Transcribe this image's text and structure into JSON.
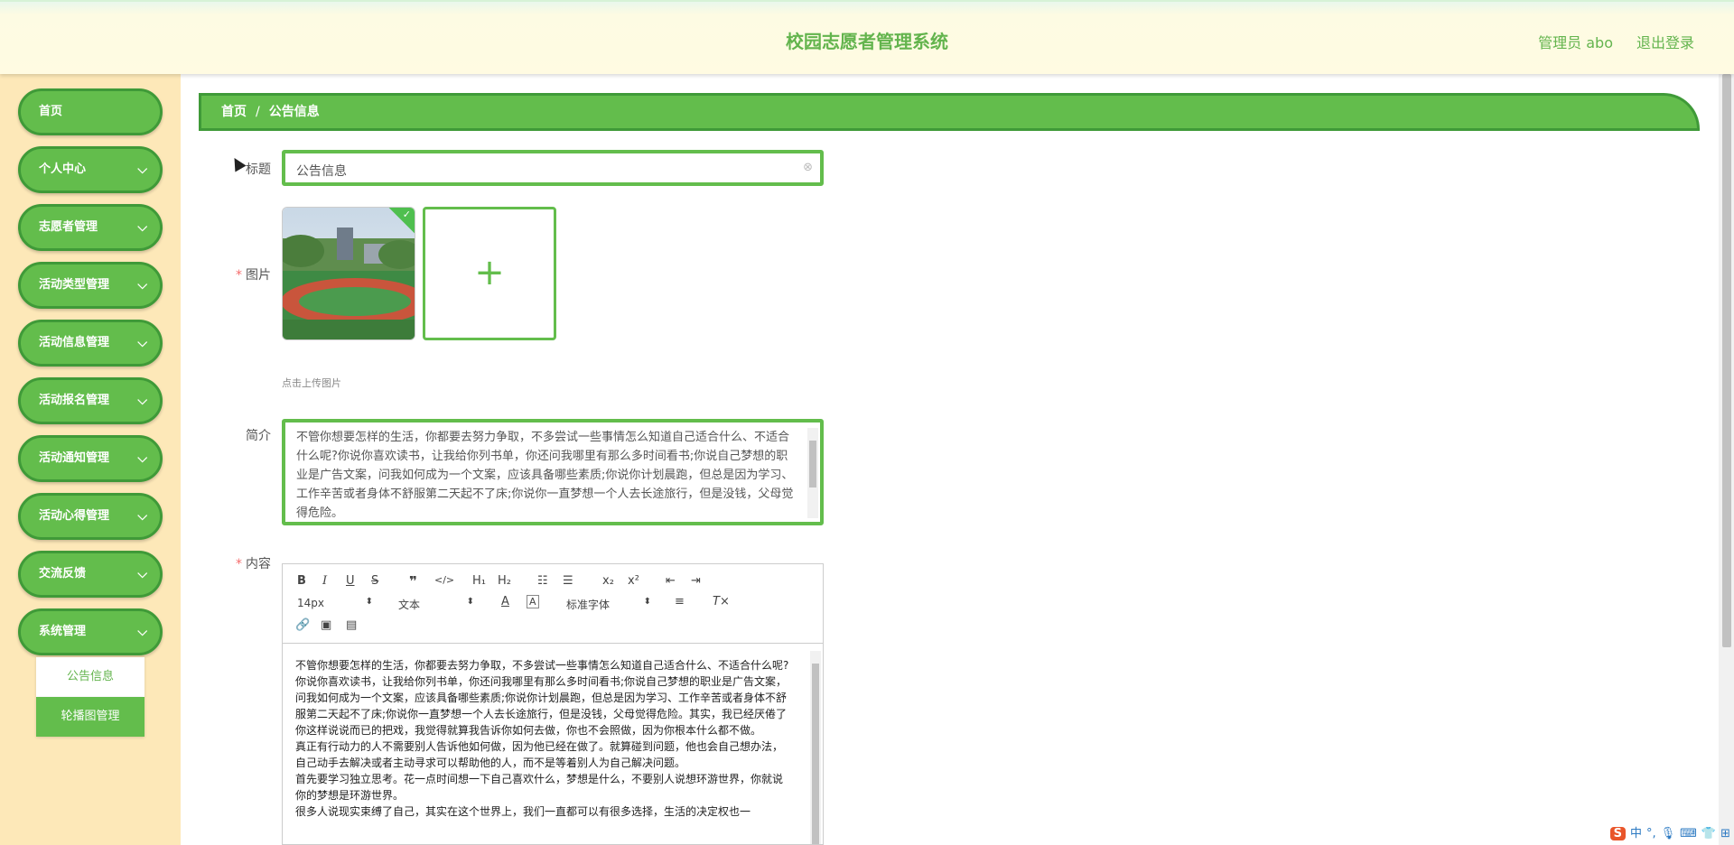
{
  "header": {
    "title": "校园志愿者管理系统",
    "admin": "管理员 abo",
    "logout": "退出登录"
  },
  "sidebar": {
    "items": [
      {
        "label": "首页",
        "has_children": false
      },
      {
        "label": "个人中心",
        "has_children": true
      },
      {
        "label": "志愿者管理",
        "has_children": true
      },
      {
        "label": "活动类型管理",
        "has_children": true
      },
      {
        "label": "活动信息管理",
        "has_children": true
      },
      {
        "label": "活动报名管理",
        "has_children": true
      },
      {
        "label": "活动通知管理",
        "has_children": true
      },
      {
        "label": "活动心得管理",
        "has_children": true
      },
      {
        "label": "交流反馈",
        "has_children": true
      },
      {
        "label": "系统管理",
        "has_children": true
      }
    ],
    "submenu": [
      {
        "label": "公告信息",
        "active": true
      },
      {
        "label": "轮播图管理",
        "active": false
      }
    ],
    "chevron_icon": "chevron-down-icon"
  },
  "breadcrumb": {
    "home": "首页",
    "separator": "/",
    "current": "公告信息"
  },
  "form": {
    "title_label": "标题",
    "title_value": "公告信息",
    "image_label": "图片",
    "upload_plus": "+",
    "upload_tip": "点击上传图片",
    "intro_label": "简介",
    "intro_value": "不管你想要怎样的生活，你都要去努力争取，不多尝试一些事情怎么知道自己适合什么、不适合什么呢?你说你喜欢读书，让我给你列书单，你还问我哪里有那么多时间看书;你说自己梦想的职业是广告文案，问我如何成为一个文案，应该具备哪些素质;你说你计划晨跑，但总是因为学习、工作辛苦或者身体不舒服第二天起不了床;你说你一直梦想一个人去长途旅行，但是没钱，父母觉得危险。",
    "content_label": "内容",
    "required_mark": "*"
  },
  "editor": {
    "font_size": "14px",
    "block_type": "文本",
    "font_family": "标准字体",
    "paragraphs": [
      "不管你想要怎样的生活，你都要去努力争取，不多尝试一些事情怎么知道自己适合什么、不适合什么呢?",
      "你说你喜欢读书，让我给你列书单，你还问我哪里有那么多时间看书;你说自己梦想的职业是广告文案，问我如何成为一个文案，应该具备哪些素质;你说你计划晨跑，但总是因为学习、工作辛苦或者身体不舒服第二天起不了床;你说你一直梦想一个人去长途旅行，但是没钱，父母觉得危险。其实，我已经厌倦了你这样说说而已的把戏，我觉得就算我告诉你如何去做，你也不会照做，因为你根本什么都不做。",
      "真正有行动力的人不需要别人告诉他如何做，因为他已经在做了。就算碰到问题，他也会自己想办法，自己动手去解决或者主动寻求可以帮助他的人，而不是等着别人为自己解决问题。",
      "首先要学习独立思考。花一点时间想一下自己喜欢什么，梦想是什么，不要别人说想环游世界，你就说你的梦想是环游世界。",
      "很多人说现实束缚了自己，其实在这个世界上，我们一直都可以有很多选择，生活的决定权也一"
    ]
  },
  "ime": {
    "logo": "S",
    "lang": "中",
    "punct": "°,"
  }
}
